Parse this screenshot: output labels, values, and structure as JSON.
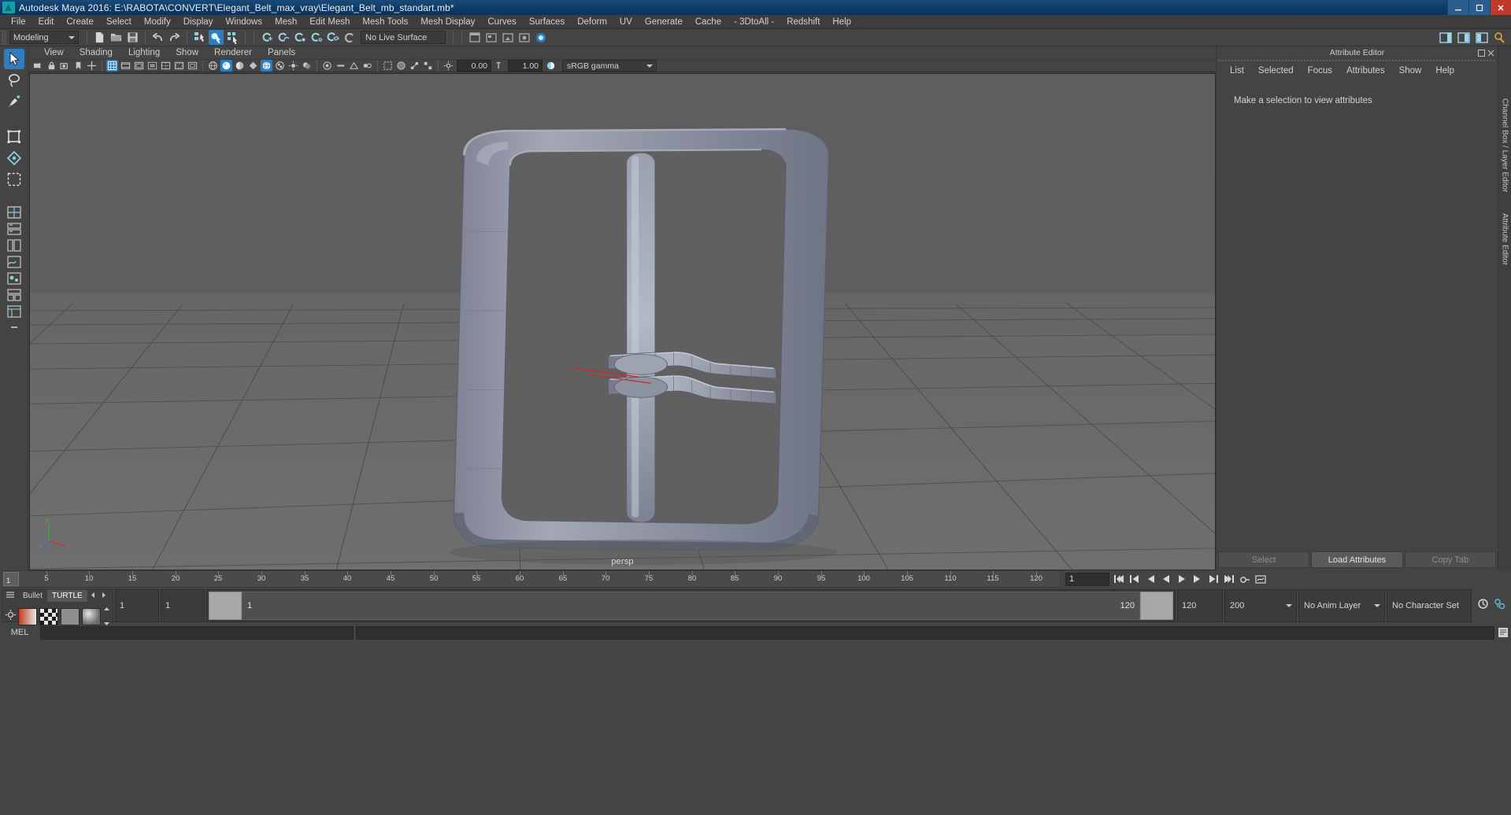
{
  "window": {
    "title": "Autodesk Maya 2016: E:\\RABOTA\\CONVERT\\Elegant_Belt_max_vray\\Elegant_Belt_mb_standart.mb*",
    "logo": "maya-logo",
    "controls": {
      "minimize": "–",
      "maximize": "□",
      "close": "✕"
    }
  },
  "menubar": {
    "items": [
      "File",
      "Edit",
      "Create",
      "Select",
      "Modify",
      "Display",
      "Windows",
      "Mesh",
      "Edit Mesh",
      "Mesh Tools",
      "Mesh Display",
      "Curves",
      "Surfaces",
      "Deform",
      "UV",
      "Generate",
      "Cache",
      "- 3DtoAll -",
      "Redshift",
      "Help"
    ]
  },
  "statusbar": {
    "menu_set": "Modeling",
    "live_surface": "No Live Surface",
    "icons": [
      "new-scene-icon",
      "open-scene-icon",
      "save-scene-icon",
      "undo-icon",
      "redo-icon",
      "select-by-hierarchy-icon",
      "select-by-object-icon",
      "select-by-component-icon",
      "snap-to-grid-icon",
      "snap-to-curve-icon",
      "snap-to-point-icon",
      "snap-to-projected-center-icon",
      "snap-to-view-plane-icon",
      "make-live-icon"
    ],
    "right_icons": [
      "show-hide-editors-icon",
      "attribute-editor-toggle-icon",
      "tool-settings-toggle-icon",
      "channel-box-toggle-icon"
    ]
  },
  "toolbox": {
    "tools": [
      {
        "name": "select-tool",
        "icon": "arrow-cursor-icon",
        "selected": true
      },
      {
        "name": "lasso-tool",
        "icon": "lasso-icon",
        "selected": false
      },
      {
        "name": "paint-select-tool",
        "icon": "paint-brush-icon",
        "selected": false
      },
      {
        "name": "move-tool",
        "icon": "move-arrows-icon",
        "selected": false
      },
      {
        "name": "rotate-tool",
        "icon": "rotate-ring-icon",
        "selected": false
      },
      {
        "name": "scale-tool",
        "icon": "scale-box-icon",
        "selected": false
      }
    ],
    "layout_buttons": [
      "single-perspective-layout-icon",
      "four-view-layout-icon",
      "persp-outliner-layout-icon",
      "persp-graph-layout-icon",
      "hypershade-layout-icon",
      "persp-hypergraph-layout-icon",
      "outliner-persp-layout-icon",
      "more-layouts-icon"
    ]
  },
  "panel": {
    "menu": [
      "View",
      "Shading",
      "Lighting",
      "Show",
      "Renderer",
      "Panels"
    ],
    "camera_label": "persp",
    "toolbar": {
      "exposure_value": "0.00",
      "gamma_value": "1.00",
      "color_space": "sRGB gamma",
      "icons": [
        "select-camera-icon",
        "lock-camera-icon",
        "camera-attributes-icon",
        "bookmark-icon",
        "image-plane-icon",
        "two-d-pan-zoom-icon",
        "grid-toggle-icon",
        "film-gate-icon",
        "resolution-gate-icon",
        "gate-mask-icon",
        "film-origin-icon",
        "safe-action-icon",
        "safe-title-icon",
        "wireframe-icon",
        "smooth-shade-all-icon",
        "smooth-shade-selected-icon",
        "flat-shade-icon",
        "wireframe-on-shaded-icon",
        "texture-toggle-icon",
        "use-all-lights-icon",
        "shadows-icon",
        "screen-space-ambient-occlusion-icon",
        "motion-blur-icon",
        "multisample-icon",
        "depth-of-field-icon",
        "isolate-select-icon",
        "xray-icon",
        "xray-joints-icon",
        "xray-active-components-icon",
        "exposure-icon",
        "gamma-icon",
        "color-management-icon"
      ]
    },
    "axis_gizmo": {
      "x": "x",
      "y": "y",
      "z": "z"
    }
  },
  "attribute_editor": {
    "panel_title": "Attribute Editor",
    "menu": [
      "List",
      "Selected",
      "Focus",
      "Attributes",
      "Show",
      "Help"
    ],
    "empty_message": "Make a selection to view attributes",
    "footer_buttons": [
      "Select",
      "Load Attributes",
      "Copy Tab"
    ],
    "dock_icons": [
      "undock-icon",
      "close-panel-icon"
    ]
  },
  "vertical_tabs": {
    "items": [
      "Channel Box / Layer Editor",
      "Attribute Editor"
    ]
  },
  "time_slider": {
    "current_frame_marker": "1",
    "current_frame_field": "1",
    "ticks": [
      5,
      10,
      15,
      20,
      25,
      30,
      35,
      40,
      45,
      50,
      55,
      60,
      65,
      70,
      75,
      80,
      85,
      90,
      95,
      100,
      105,
      110,
      115,
      120
    ],
    "playback_buttons": [
      "go-to-start-icon",
      "step-back-frame-icon",
      "step-back-key-icon",
      "play-backwards-icon",
      "play-forwards-icon",
      "step-forward-key-icon",
      "step-forward-frame-icon",
      "go-to-end-icon"
    ],
    "extra_buttons": [
      "auto-key-icon",
      "animation-preferences-icon"
    ]
  },
  "range_slider": {
    "start_field": "1",
    "playback_start_field": "1",
    "range_start_label": "1",
    "range_end_label": "120",
    "playback_end_field": "120",
    "end_field": "200",
    "anim_layer": "No Anim Layer",
    "character_set": "No Character Set",
    "end_icons": [
      "auto-keyframe-icon",
      "animation-preferences-icon"
    ]
  },
  "shelf_mini": {
    "tabs": [
      "Bullet",
      "TURTLE"
    ],
    "active_tab": "TURTLE",
    "nav_icons": [
      "prev-shelf-icon",
      "next-shelf-icon"
    ],
    "menu_icon": "shelf-menu-icon",
    "settings_icon": "shelf-settings-icon",
    "swatches": [
      "turtle-render-icon",
      "checker-swatch-icon",
      "grey-swatch-icon",
      "sphere-swatch-icon"
    ],
    "scroll_icons": [
      "scroll-up-icon",
      "scroll-down-icon"
    ]
  },
  "command_line": {
    "language_label": "MEL",
    "input_value": "",
    "output_value": "",
    "script_editor_icon": "script-editor-icon"
  },
  "colors": {
    "accent_blue": "#2e7dbf",
    "title_blue": "#0e3a66",
    "panel_bg": "#444444",
    "viewport_sky": "#606060",
    "viewport_ground": "#6a6a6a",
    "model_grey": "#9296a5",
    "close_red": "#c0392b"
  },
  "viewport_scene": {
    "object": "belt-buckle-model",
    "shading": "smooth-shaded",
    "grid_visible": true,
    "manipulator_axis_color": "#c03030"
  }
}
